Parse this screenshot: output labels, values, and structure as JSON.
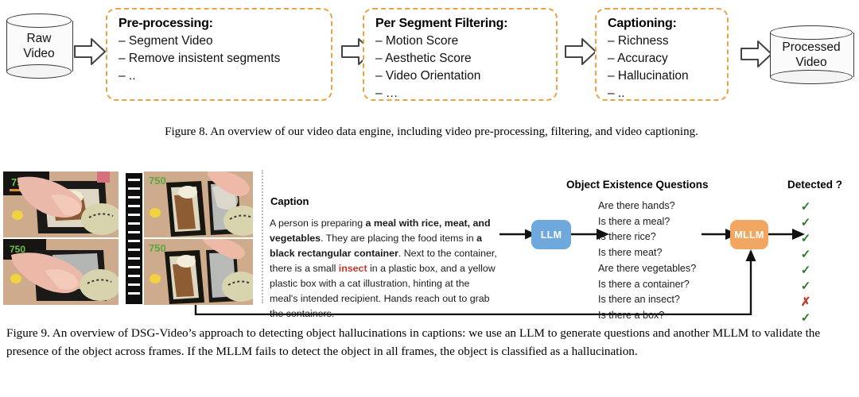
{
  "figure8": {
    "source": {
      "lines": [
        "Raw",
        "Video"
      ]
    },
    "sink": {
      "lines": [
        "Processed",
        "Video"
      ]
    },
    "stages": [
      {
        "title": "Pre-processing:",
        "items": [
          "– Segment Video",
          "– Remove insistent segments",
          "– .."
        ]
      },
      {
        "title": "Per Segment Filtering:",
        "items": [
          "– Motion Score",
          "– Aesthetic Score",
          "– Video Orientation",
          "– …"
        ]
      },
      {
        "title": "Captioning:",
        "items": [
          "– Richness",
          "– Accuracy",
          "– Hallucination",
          "– .."
        ]
      }
    ],
    "caption": "Figure 8. An overview of our video data engine, including video pre-processing, filtering, and video captioning."
  },
  "figure9": {
    "caption_panel": {
      "heading": "Caption",
      "segments": [
        {
          "text": "A person is preparing ",
          "style": "normal"
        },
        {
          "text": "a meal with rice, meat, and vegetables",
          "style": "bold"
        },
        {
          "text": ". They are placing the food items in ",
          "style": "normal"
        },
        {
          "text": "a black rectangular container",
          "style": "bold"
        },
        {
          "text": ". Next to the container, there is a small ",
          "style": "normal"
        },
        {
          "text": "insect",
          "style": "red-bold"
        },
        {
          "text": " in a plastic box, and a yellow plastic box with a cat illustration, hinting at the meal's intended recipient. Hands reach out to grab the containers.",
          "style": "normal"
        }
      ]
    },
    "llm_node": {
      "label": "LLM",
      "color": "#6fa8dc"
    },
    "mllm_node": {
      "label": "MLLM",
      "color": "#f1a661"
    },
    "questions_title": "Object Existence Questions",
    "questions": [
      "Are there hands?",
      "Is there a meal?",
      "Is there rice?",
      "Is there meat?",
      "Are there vegetables?",
      "Is there a container?",
      "Is there an insect?",
      "Is there a box?"
    ],
    "detected_title": "Detected ?",
    "detected": [
      "✓",
      "✓",
      "✓",
      "✓",
      "✓",
      "✓",
      "✗",
      "✓"
    ],
    "detected_states": [
      "ok",
      "ok",
      "ok",
      "ok",
      "ok",
      "ok",
      "no",
      "ok"
    ],
    "caption": "Figure 9. An overview of DSG-Video’s approach to detecting object hallucinations in captions: we use an LLM to generate questions and another MLLM to validate the presence of the object across frames. If the MLLM fails to detect the object in all frames, the object is classified as a hallucination."
  },
  "colors": {
    "dashed_border": "#e9a343",
    "llm_blue": "#6fa8dc",
    "mllm_orange": "#f1a661",
    "check_green": "#2c7a2c",
    "cross_red": "#c0392b"
  }
}
